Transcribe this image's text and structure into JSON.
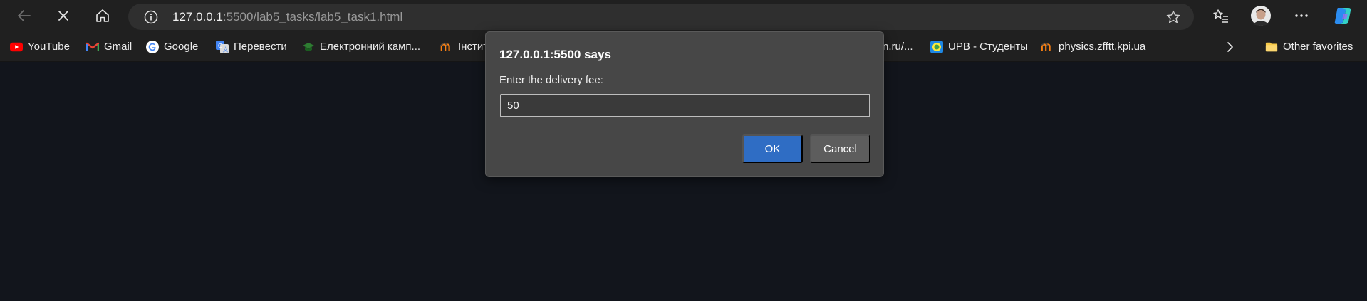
{
  "browser": {
    "url_host": "127.0.0.1",
    "url_rest": ":5500/lab5_tasks/lab5_task1.html",
    "icons": {
      "back": "back-arrow-icon",
      "stop": "close-icon",
      "home": "home-icon",
      "info": "info-icon",
      "favorite": "star-icon",
      "favorites": "favorites-list-icon",
      "profile": "avatar",
      "more": "more-icon",
      "copilot": "copilot-icon"
    }
  },
  "bookmarks": {
    "items": [
      {
        "label": "YouTube",
        "icon": "youtube-icon",
        "color": "#ff0000"
      },
      {
        "label": "Gmail",
        "icon": "gmail-icon",
        "color": "#ea4335"
      },
      {
        "label": "Google",
        "icon": "google-icon",
        "color": "#4285f4"
      },
      {
        "label": "Перевести",
        "icon": "translate-icon",
        "color": "#4285f4"
      },
      {
        "label": "Електронний камп...",
        "icon": "graduation-cap-icon",
        "color": "#2e7d32"
      },
      {
        "label": "Інстит",
        "icon": "moodle-icon",
        "color": "#f98012"
      },
      {
        "label": "n.ru/...",
        "icon": "",
        "color": ""
      },
      {
        "label": "UPB - Студенты",
        "icon": "upb-icon",
        "color": "#1e88e5"
      },
      {
        "label": "physics.zfftt.kpi.ua",
        "icon": "moodle-icon",
        "color": "#f98012"
      }
    ],
    "overflow_icon": "chevron-right-icon",
    "other_favorites": "Other favorites",
    "other_favorites_icon": "folder-icon"
  },
  "dialog": {
    "title": "127.0.0.1:5500 says",
    "message": "Enter the delivery fee:",
    "input_value": "50",
    "ok_label": "OK",
    "cancel_label": "Cancel",
    "accent": "#2f6dc4"
  }
}
